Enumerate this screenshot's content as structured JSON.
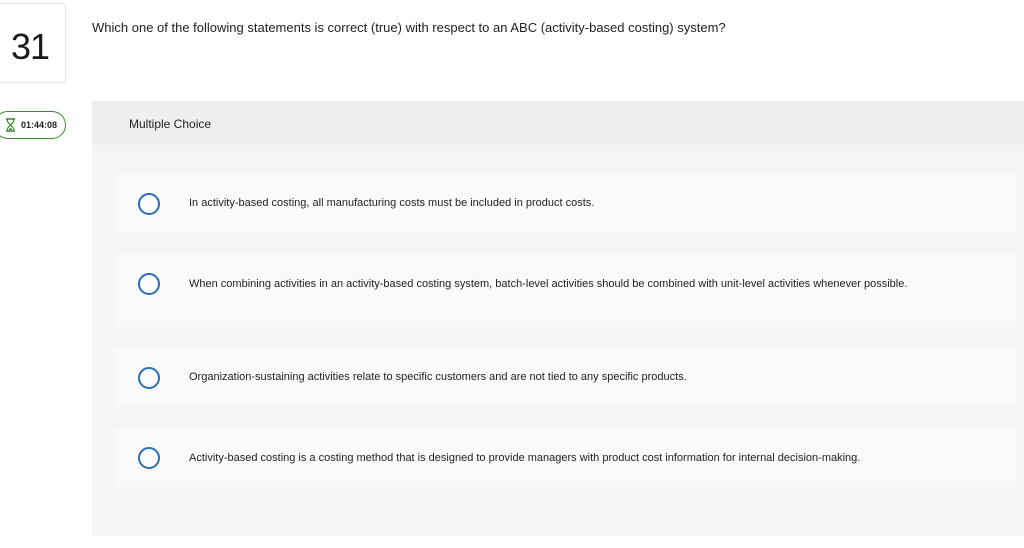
{
  "question_number": "31",
  "timer": {
    "icon": "hourglass-icon",
    "value": "01:44:08",
    "color": "#3c8a2f"
  },
  "question_text": "Which one of the following statements is correct (true) with respect to an ABC (activity-based costing) system?",
  "answer_panel": {
    "header_label": "Multiple Choice",
    "options": [
      {
        "label": "In activity-based costing, all manufacturing costs must be included in product costs."
      },
      {
        "label": "When combining activities in an activity-based costing system, batch-level activities should be combined with unit-level activities whenever possible."
      },
      {
        "label": "Organization-sustaining activities relate to specific customers and are not tied to any specific products."
      },
      {
        "label": "Activity-based costing is a costing method that is designed to provide managers with product cost information for internal decision-making."
      }
    ]
  },
  "colors": {
    "radio_border": "#2b6cb8",
    "panel_bg": "#f5f5f5"
  }
}
